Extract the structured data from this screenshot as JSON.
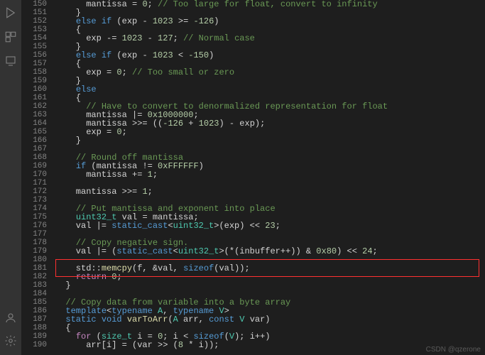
{
  "activity_icons": [
    "run-debug-icon",
    "extensions-icon",
    "source-control-icon"
  ],
  "activity_bottom": [
    "accounts-icon",
    "settings-gear-icon"
  ],
  "watermark": "CSDN @qzerone",
  "highlight_line": 181,
  "first_line_number": 150,
  "code_lines": [
    {
      "n": 150,
      "tok": [
        [
          "      mantissa ",
          "op"
        ],
        [
          "=",
          "op"
        ],
        [
          " ",
          "op"
        ],
        [
          "0",
          "num"
        ],
        [
          ";",
          "op"
        ],
        [
          " ",
          "op"
        ],
        [
          "// Too large for float, convert to infinity",
          "green"
        ]
      ]
    },
    {
      "n": 151,
      "tok": [
        [
          "    }",
          "op"
        ]
      ]
    },
    {
      "n": 152,
      "tok": [
        [
          "    ",
          "op"
        ],
        [
          "else if",
          "blue"
        ],
        [
          " (exp ",
          "op"
        ],
        [
          "-",
          "op"
        ],
        [
          " ",
          "op"
        ],
        [
          "1023",
          "num"
        ],
        [
          " >= ",
          "op"
        ],
        [
          "-126",
          "num"
        ],
        [
          ")",
          "op"
        ]
      ]
    },
    {
      "n": 153,
      "tok": [
        [
          "    {",
          "op"
        ]
      ]
    },
    {
      "n": 154,
      "tok": [
        [
          "      exp ",
          "op"
        ],
        [
          "-=",
          "op"
        ],
        [
          " ",
          "op"
        ],
        [
          "1023",
          "num"
        ],
        [
          " ",
          "op"
        ],
        [
          "-",
          "op"
        ],
        [
          " ",
          "op"
        ],
        [
          "127",
          "num"
        ],
        [
          ";",
          "op"
        ],
        [
          " ",
          "op"
        ],
        [
          "// Normal case",
          "green"
        ]
      ]
    },
    {
      "n": 155,
      "tok": [
        [
          "    }",
          "op"
        ]
      ]
    },
    {
      "n": 156,
      "tok": [
        [
          "    ",
          "op"
        ],
        [
          "else if",
          "blue"
        ],
        [
          " (exp ",
          "op"
        ],
        [
          "-",
          "op"
        ],
        [
          " ",
          "op"
        ],
        [
          "1023",
          "num"
        ],
        [
          " < ",
          "op"
        ],
        [
          "-150",
          "num"
        ],
        [
          ")",
          "op"
        ]
      ]
    },
    {
      "n": 157,
      "tok": [
        [
          "    {",
          "op"
        ]
      ]
    },
    {
      "n": 158,
      "tok": [
        [
          "      exp ",
          "op"
        ],
        [
          "=",
          "op"
        ],
        [
          " ",
          "op"
        ],
        [
          "0",
          "num"
        ],
        [
          ";",
          "op"
        ],
        [
          " ",
          "op"
        ],
        [
          "// Too small or zero",
          "green"
        ]
      ]
    },
    {
      "n": 159,
      "tok": [
        [
          "    }",
          "op"
        ]
      ]
    },
    {
      "n": 160,
      "tok": [
        [
          "    ",
          "op"
        ],
        [
          "else",
          "blue"
        ]
      ]
    },
    {
      "n": 161,
      "tok": [
        [
          "    {",
          "op"
        ]
      ]
    },
    {
      "n": 162,
      "tok": [
        [
          "      ",
          "op"
        ],
        [
          "// Have to convert to denormalized representation for float",
          "green"
        ]
      ]
    },
    {
      "n": 163,
      "tok": [
        [
          "      mantissa ",
          "op"
        ],
        [
          "|=",
          "op"
        ],
        [
          " ",
          "op"
        ],
        [
          "0x1000000",
          "num"
        ],
        [
          ";",
          "op"
        ]
      ]
    },
    {
      "n": 164,
      "tok": [
        [
          "      mantissa ",
          "op"
        ],
        [
          ">>=",
          "op"
        ],
        [
          " ((",
          "op"
        ],
        [
          "-126",
          "num"
        ],
        [
          " + ",
          "op"
        ],
        [
          "1023",
          "num"
        ],
        [
          ") ",
          "op"
        ],
        [
          "-",
          "op"
        ],
        [
          " exp);",
          "op"
        ]
      ]
    },
    {
      "n": 165,
      "tok": [
        [
          "      exp ",
          "op"
        ],
        [
          "=",
          "op"
        ],
        [
          " ",
          "op"
        ],
        [
          "0",
          "num"
        ],
        [
          ";",
          "op"
        ]
      ]
    },
    {
      "n": 166,
      "tok": [
        [
          "    }",
          "op"
        ]
      ]
    },
    {
      "n": 167,
      "tok": []
    },
    {
      "n": 168,
      "tok": [
        [
          "    ",
          "op"
        ],
        [
          "// Round off mantissa",
          "green"
        ]
      ]
    },
    {
      "n": 169,
      "tok": [
        [
          "    ",
          "op"
        ],
        [
          "if",
          "blue"
        ],
        [
          " (mantissa ",
          "op"
        ],
        [
          "!=",
          "op"
        ],
        [
          " ",
          "op"
        ],
        [
          "0xFFFFFF",
          "num"
        ],
        [
          ")",
          "op"
        ]
      ]
    },
    {
      "n": 170,
      "tok": [
        [
          "      mantissa ",
          "op"
        ],
        [
          "+=",
          "op"
        ],
        [
          " ",
          "op"
        ],
        [
          "1",
          "num"
        ],
        [
          ";",
          "op"
        ]
      ]
    },
    {
      "n": 171,
      "tok": []
    },
    {
      "n": 172,
      "tok": [
        [
          "    mantissa ",
          "op"
        ],
        [
          ">>=",
          "op"
        ],
        [
          " ",
          "op"
        ],
        [
          "1",
          "num"
        ],
        [
          ";",
          "op"
        ]
      ]
    },
    {
      "n": 173,
      "tok": []
    },
    {
      "n": 174,
      "tok": [
        [
          "    ",
          "op"
        ],
        [
          "// Put mantissa and exponent into place",
          "green"
        ]
      ]
    },
    {
      "n": 175,
      "tok": [
        [
          "    ",
          "op"
        ],
        [
          "uint32_t",
          "cyan"
        ],
        [
          " val ",
          "op"
        ],
        [
          "=",
          "op"
        ],
        [
          " mantissa;",
          "op"
        ]
      ]
    },
    {
      "n": 176,
      "tok": [
        [
          "    val ",
          "op"
        ],
        [
          "|=",
          "op"
        ],
        [
          " ",
          "op"
        ],
        [
          "static_cast",
          "blue"
        ],
        [
          "<",
          "op"
        ],
        [
          "uint32_t",
          "cyan"
        ],
        [
          ">(exp) ",
          "op"
        ],
        [
          "<<",
          "op"
        ],
        [
          " ",
          "op"
        ],
        [
          "23",
          "num"
        ],
        [
          ";",
          "op"
        ]
      ]
    },
    {
      "n": 177,
      "tok": []
    },
    {
      "n": 178,
      "tok": [
        [
          "    ",
          "op"
        ],
        [
          "// Copy negative sign.",
          "green"
        ]
      ]
    },
    {
      "n": 179,
      "tok": [
        [
          "    val ",
          "op"
        ],
        [
          "|=",
          "op"
        ],
        [
          " (",
          "op"
        ],
        [
          "static_cast",
          "blue"
        ],
        [
          "<",
          "op"
        ],
        [
          "uint32_t",
          "cyan"
        ],
        [
          ">(",
          "op"
        ],
        [
          "*",
          "op"
        ],
        [
          "(inbuffer",
          "op"
        ],
        [
          "++",
          "op"
        ],
        [
          ")) ",
          "op"
        ],
        [
          "&",
          "op"
        ],
        [
          " ",
          "op"
        ],
        [
          "0x80",
          "num"
        ],
        [
          ") ",
          "op"
        ],
        [
          "<<",
          "op"
        ],
        [
          " ",
          "op"
        ],
        [
          "24",
          "num"
        ],
        [
          ";",
          "op"
        ]
      ]
    },
    {
      "n": 180,
      "tok": []
    },
    {
      "n": 181,
      "tok": [
        [
          "    std::",
          "op"
        ],
        [
          "memcpy",
          "yellow"
        ],
        [
          "(f, ",
          "op"
        ],
        [
          "&",
          "op"
        ],
        [
          "val, ",
          "op"
        ],
        [
          "sizeof",
          "blue"
        ],
        [
          "(val));",
          "op"
        ]
      ]
    },
    {
      "n": 182,
      "tok": [
        [
          "    ",
          "op"
        ],
        [
          "return",
          "purple"
        ],
        [
          " ",
          "op"
        ],
        [
          "0",
          "num"
        ],
        [
          ";",
          "op"
        ]
      ]
    },
    {
      "n": 183,
      "tok": [
        [
          "  }",
          "op"
        ]
      ]
    },
    {
      "n": 184,
      "tok": []
    },
    {
      "n": 185,
      "tok": [
        [
          "  ",
          "op"
        ],
        [
          "// Copy data from variable into a byte array",
          "green"
        ]
      ]
    },
    {
      "n": 186,
      "tok": [
        [
          "  ",
          "op"
        ],
        [
          "template",
          "blue"
        ],
        [
          "<",
          "op"
        ],
        [
          "typename",
          "blue"
        ],
        [
          " ",
          "op"
        ],
        [
          "A",
          "cyan"
        ],
        [
          ", ",
          "op"
        ],
        [
          "typename",
          "blue"
        ],
        [
          " ",
          "op"
        ],
        [
          "V",
          "cyan"
        ],
        [
          ">",
          "op"
        ]
      ]
    },
    {
      "n": 187,
      "tok": [
        [
          "  ",
          "op"
        ],
        [
          "static",
          "blue"
        ],
        [
          " ",
          "op"
        ],
        [
          "void",
          "blue"
        ],
        [
          " ",
          "op"
        ],
        [
          "varToArr",
          "yellow"
        ],
        [
          "(",
          "op"
        ],
        [
          "A",
          "cyan"
        ],
        [
          " arr, ",
          "op"
        ],
        [
          "const",
          "blue"
        ],
        [
          " ",
          "op"
        ],
        [
          "V",
          "cyan"
        ],
        [
          " var)",
          "op"
        ]
      ]
    },
    {
      "n": 188,
      "tok": [
        [
          "  {",
          "op"
        ]
      ]
    },
    {
      "n": 189,
      "tok": [
        [
          "    ",
          "op"
        ],
        [
          "for",
          "purple"
        ],
        [
          " (",
          "op"
        ],
        [
          "size_t",
          "cyan"
        ],
        [
          " i ",
          "op"
        ],
        [
          "=",
          "op"
        ],
        [
          " ",
          "op"
        ],
        [
          "0",
          "num"
        ],
        [
          "; i ",
          "op"
        ],
        [
          "<",
          "op"
        ],
        [
          " ",
          "op"
        ],
        [
          "sizeof",
          "blue"
        ],
        [
          "(",
          "op"
        ],
        [
          "V",
          "cyan"
        ],
        [
          "); i",
          "op"
        ],
        [
          "++",
          "op"
        ],
        [
          ")",
          "op"
        ]
      ]
    },
    {
      "n": 190,
      "tok": [
        [
          "      arr[i] ",
          "op"
        ],
        [
          "=",
          "op"
        ],
        [
          " (var ",
          "op"
        ],
        [
          ">>",
          "op"
        ],
        [
          " (",
          "op"
        ],
        [
          "8",
          "num"
        ],
        [
          " * i));",
          "op"
        ]
      ]
    }
  ]
}
